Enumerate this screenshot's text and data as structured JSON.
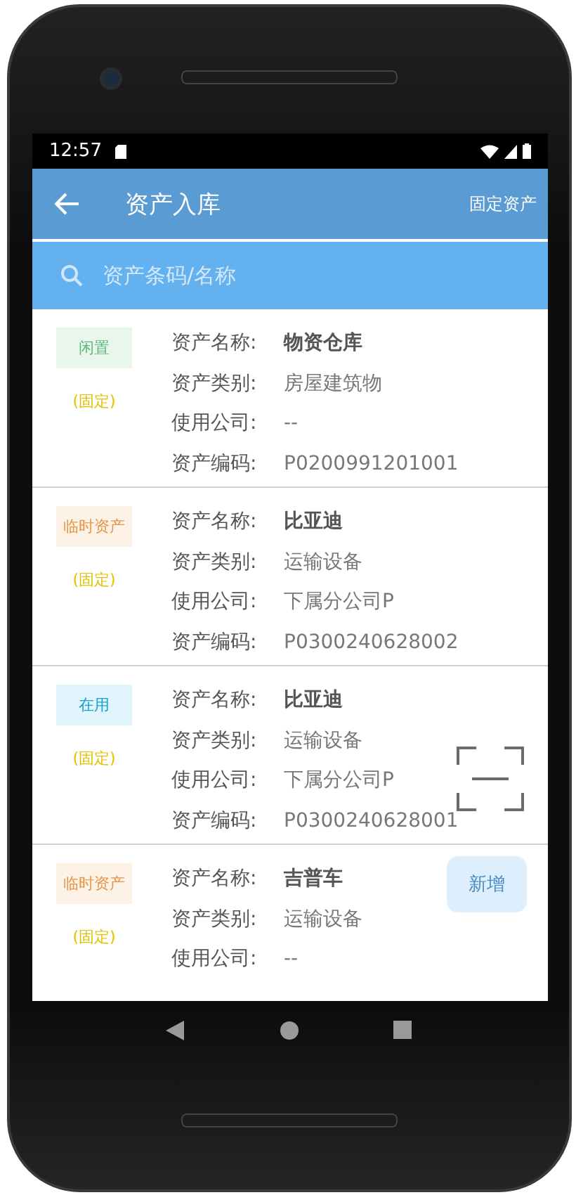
{
  "status_bar": {
    "time": "12:57"
  },
  "app_bar": {
    "title": "资产入库",
    "action": "固定资产"
  },
  "search": {
    "placeholder": "资产条码/名称"
  },
  "assets": [
    {
      "status": {
        "text": "闲置",
        "kind": "idle"
      },
      "tag": "(固定)",
      "fields": [
        {
          "label": "资产名称:",
          "value": "物资仓库"
        },
        {
          "label": "资产类别:",
          "value": "房屋建筑物"
        },
        {
          "label": "使用公司:",
          "value": "--"
        },
        {
          "label": "资产编码:",
          "value": "P0200991201001"
        }
      ]
    },
    {
      "status": {
        "text": "临时资产",
        "kind": "temporary"
      },
      "tag": "(固定)",
      "fields": [
        {
          "label": "资产名称:",
          "value": "比亚迪"
        },
        {
          "label": "资产类别:",
          "value": "运输设备"
        },
        {
          "label": "使用公司:",
          "value": "下属分公司P"
        },
        {
          "label": "资产编码:",
          "value": "P0300240628002"
        }
      ]
    },
    {
      "status": {
        "text": "在用",
        "kind": "in_use"
      },
      "tag": "(固定)",
      "fields": [
        {
          "label": "资产名称:",
          "value": "比亚迪"
        },
        {
          "label": "资产类别:",
          "value": "运输设备"
        },
        {
          "label": "使用公司:",
          "value": "下属分公司P"
        },
        {
          "label": "资产编码:",
          "value": "P0300240628001"
        }
      ]
    },
    {
      "status": {
        "text": "临时资产",
        "kind": "temporary"
      },
      "tag": "(固定)",
      "fields": [
        {
          "label": "资产名称:",
          "value": "吉普车"
        },
        {
          "label": "资产类别:",
          "value": "运输设备"
        },
        {
          "label": "使用公司:",
          "value": "--"
        }
      ]
    }
  ],
  "add_button": {
    "label": "新增"
  }
}
